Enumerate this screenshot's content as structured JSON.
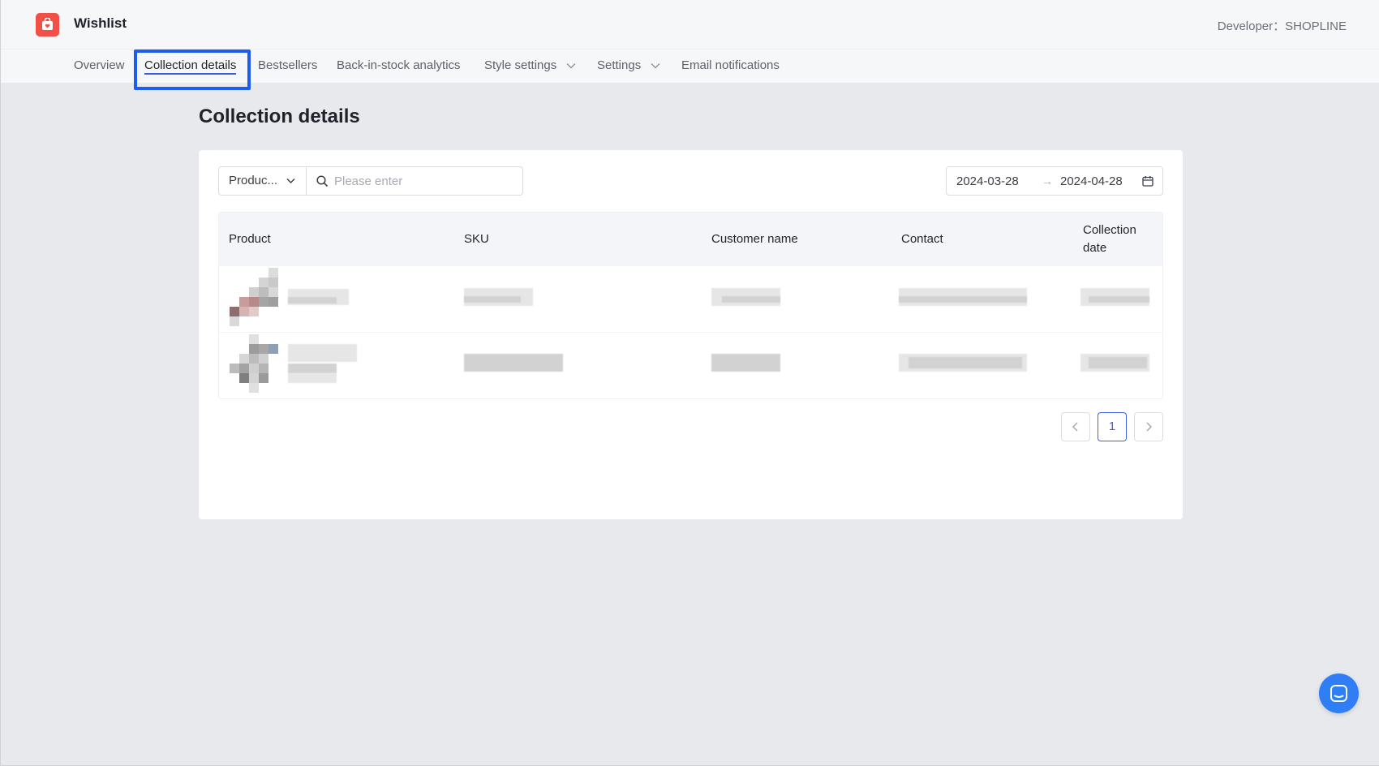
{
  "header": {
    "app_title": "Wishlist",
    "developer": "Developer：SHOPLINE"
  },
  "nav": {
    "items": [
      {
        "label": "Overview"
      },
      {
        "label": "Collection details"
      },
      {
        "label": "Bestsellers"
      },
      {
        "label": "Back-in-stock analytics"
      },
      {
        "label": "Style settings"
      },
      {
        "label": "Settings"
      },
      {
        "label": "Email notifications"
      }
    ],
    "active_label": "Collection details"
  },
  "page": {
    "title": "Collection details"
  },
  "filters": {
    "field_select": "Produc...",
    "search_placeholder": "Please enter",
    "date_start": "2024-03-28",
    "date_separator": "→",
    "date_end": "2024-04-28"
  },
  "table": {
    "columns": [
      "Product",
      "SKU",
      "Customer name",
      "Contact",
      "Collection date"
    ],
    "rows_note_hidden": true
  },
  "pagination": {
    "current_page": "1"
  },
  "colors": {
    "accent": "#3d5ee5",
    "logo": "#f24f47",
    "highlight": "#1d5cf0",
    "chat": "#2f7ef5"
  },
  "icons": [
    "wishlist-logo-icon",
    "chevron-down-icon",
    "search-icon",
    "calendar-icon",
    "chevron-left-icon",
    "chevron-right-icon",
    "chat-icon"
  ]
}
